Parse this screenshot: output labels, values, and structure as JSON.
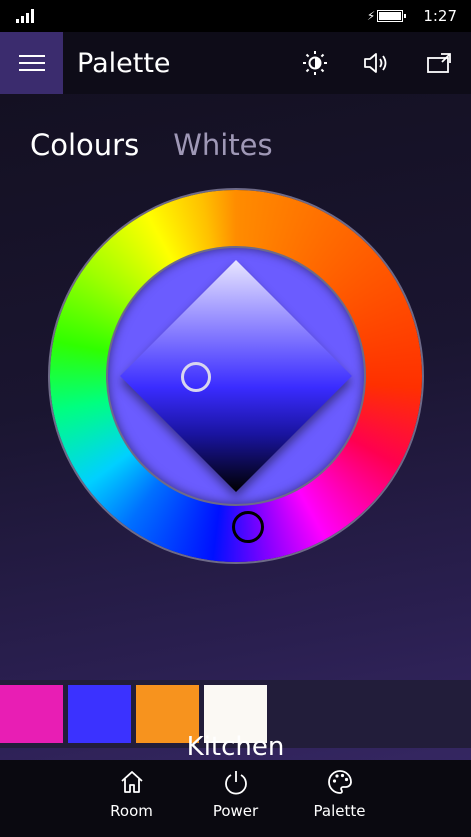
{
  "status": {
    "time": "1:27"
  },
  "header": {
    "title": "Palette",
    "icons": [
      "menu-icon",
      "brightness-icon",
      "volume-icon",
      "cast-icon"
    ]
  },
  "tabs": [
    {
      "label": "Colours",
      "active": true
    },
    {
      "label": "Whites",
      "active": false
    }
  ],
  "colors": {
    "accent": "#3b2c6e",
    "selected_color": "#6b5cff"
  },
  "swatches": [
    {
      "color": "#e81eb4"
    },
    {
      "color": "#3b32ff"
    },
    {
      "color": "#f7931e"
    },
    {
      "color": "#fbf9f4"
    }
  ],
  "room": {
    "name": "Kitchen"
  },
  "nav": [
    {
      "label": "Room",
      "icon": "home-icon"
    },
    {
      "label": "Power",
      "icon": "power-icon"
    },
    {
      "label": "Palette",
      "icon": "palette-icon"
    }
  ]
}
